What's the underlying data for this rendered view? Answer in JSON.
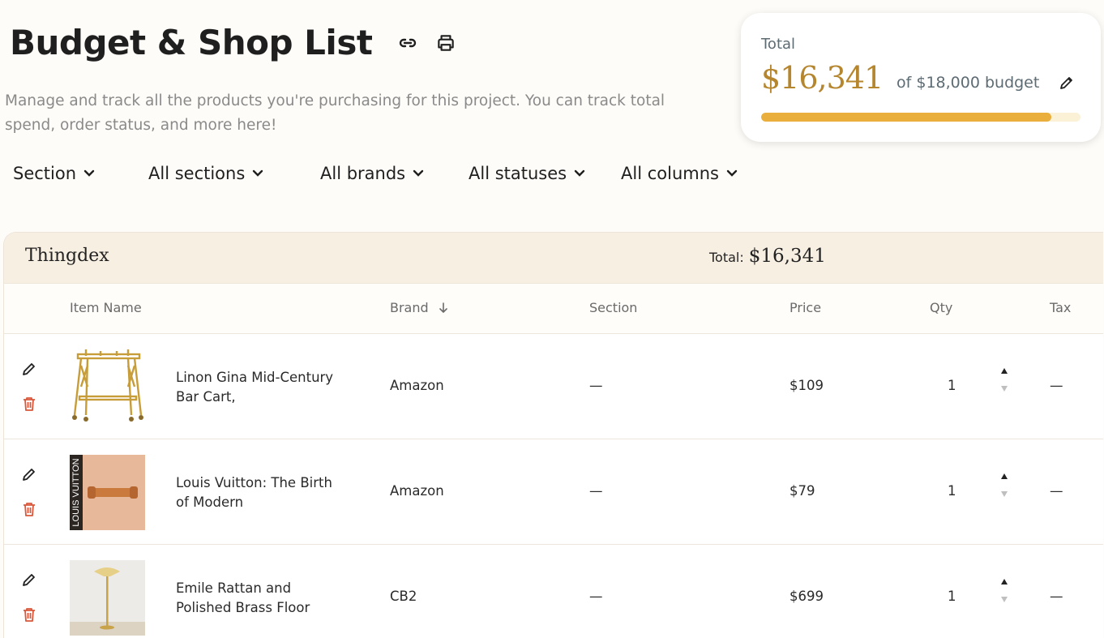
{
  "header": {
    "title": "Budget & Shop List",
    "subtitle": "Manage and track all the products you're purchasing for this project. You can track total spend, order status, and more here!",
    "link_icon": "link-icon",
    "print_icon": "printer-icon"
  },
  "budget": {
    "label": "Total",
    "amount": "$16,341",
    "of_text": "of $18,000 budget",
    "progress_fraction": 0.908,
    "accent": "#b5862e",
    "bar_color": "#e9ae3b"
  },
  "filters": [
    {
      "label": "Section"
    },
    {
      "label": "All sections"
    },
    {
      "label": "All brands"
    },
    {
      "label": "All statuses"
    },
    {
      "label": "All columns"
    }
  ],
  "group": {
    "name": "Thingdex",
    "total_label": "Total:",
    "total_value": "$16,341"
  },
  "columns": {
    "item_name": "Item Name",
    "brand": "Brand",
    "brand_sort_icon": "arrow-down-icon",
    "section": "Section",
    "price": "Price",
    "qty": "Qty",
    "tax": "Tax"
  },
  "items": [
    {
      "name": "Linon Gina Mid-Century Bar Cart,",
      "brand": "Amazon",
      "section": "—",
      "price": "$109",
      "qty": "1",
      "tax": "—"
    },
    {
      "name": "Louis Vuitton: The Birth of Modern",
      "brand": "Amazon",
      "section": "—",
      "price": "$79",
      "qty": "1",
      "tax": "—",
      "image_text": "LOUIS VUITTON"
    },
    {
      "name": "Emile Rattan and Polished Brass Floor",
      "brand": "CB2",
      "section": "—",
      "price": "$699",
      "qty": "1",
      "tax": "—"
    }
  ],
  "colors": {
    "delete_icon": "#d9583b",
    "background": "#fefcf8",
    "group_header": "#f8efe3"
  }
}
